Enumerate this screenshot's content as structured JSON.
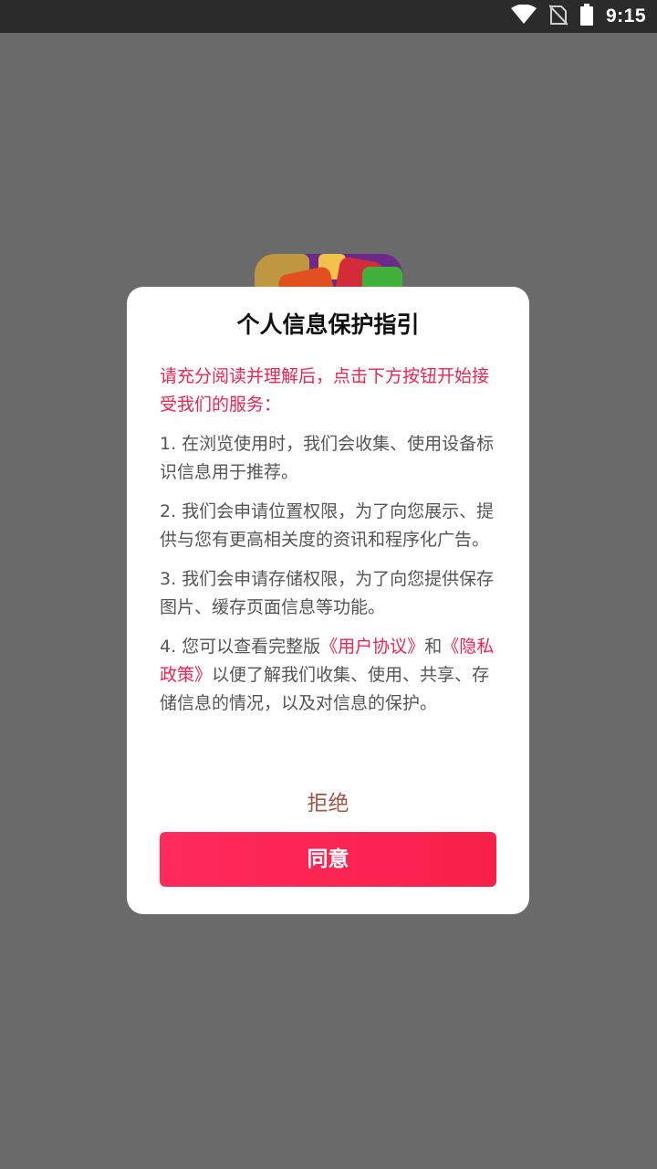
{
  "status_bar": {
    "time": "9:15",
    "icons": [
      "wifi-icon",
      "no-sim-icon",
      "battery-icon"
    ]
  },
  "app": {
    "icon": "app-icon"
  },
  "dialog": {
    "title": "个人信息保护指引",
    "intro": "请充分阅读并理解后，点击下方按钮开始接受我们的服务：",
    "items": [
      {
        "text": "1. 在浏览使用时，我们会收集、使用设备标识信息用于推荐。"
      },
      {
        "text": "2. 我们会申请位置权限，为了向您展示、提供与您有更高相关度的资讯和程序化广告。"
      },
      {
        "text": "3. 我们会申请存储权限，为了向您提供保存图片、缓存页面信息等功能。"
      }
    ],
    "item4": {
      "prefix": "4. 您可以查看完整版",
      "user_agreement_link": "《用户协议》",
      "middle": "和",
      "privacy_policy_link": "《隐私政策》",
      "suffix": "以便了解我们收集、使用、共享、存储信息的情况，以及对信息的保护。"
    },
    "reject_label": "拒绝",
    "agree_label": "同意"
  },
  "colors": {
    "overlay": "#6a6a6a",
    "status_bar": "#2b2b2b",
    "accent": "#f0244f",
    "reject_text": "#a0574a",
    "body_text": "#555555"
  }
}
